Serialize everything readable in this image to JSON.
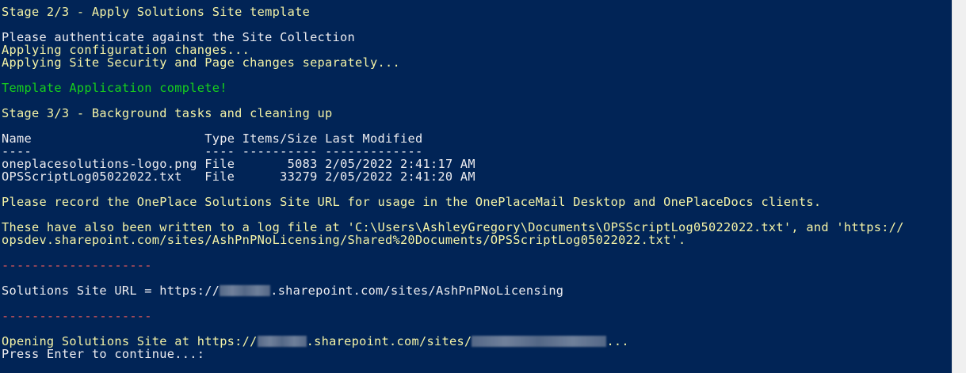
{
  "console": {
    "stage2_title": "Stage 2/3 - Apply Solutions Site template",
    "auth_prompt": "Please authenticate against the Site Collection",
    "applying_config": "Applying configuration changes...",
    "applying_security": "Applying Site Security and Page changes separately...",
    "template_complete": "Template Application complete!",
    "stage3_title": "Stage 3/3 - Background tasks and cleaning up",
    "table": {
      "headers": [
        "Name",
        "Type",
        "Items/Size",
        "Last Modified"
      ],
      "underline": [
        "----",
        "----",
        "----------",
        "-------------"
      ],
      "rows": [
        {
          "name": "oneplacesolutions-logo.png",
          "type": "File",
          "size": "5083",
          "modified": "2/05/2022 2:41:17 AM"
        },
        {
          "name": "OPSScriptLog05022022.txt",
          "type": "File",
          "size": "33279",
          "modified": "2/05/2022 2:41:20 AM"
        }
      ]
    },
    "record_url_msg": "Please record the OnePlace Solutions Site URL for usage in the OnePlaceMail Desktop and OnePlaceDocs clients.",
    "log_msg_line1": "These have also been written to a log file at 'C:\\Users\\AshleyGregory\\Documents\\OPSScriptLog05022022.txt', and 'https://",
    "log_msg_line2": "opsdev.sharepoint.com/sites/AshPnPNoLicensing/Shared%20Documents/OPSScriptLog05022022.txt'.",
    "separator": "--------------------",
    "site_url_prefix": "Solutions Site URL = https://",
    "site_url_suffix": ".sharepoint.com/sites/AshPnPNoLicensing",
    "opening_prefix": "Opening Solutions Site at https://",
    "opening_middle": ".sharepoint.com/sites/",
    "opening_suffix": "...",
    "press_enter": "Press Enter to continue...:"
  },
  "colors": {
    "background": "#012456",
    "yellow": "#f5f3a6",
    "white": "#eeedf0",
    "green": "#17d11c",
    "red": "#e85a5a"
  }
}
